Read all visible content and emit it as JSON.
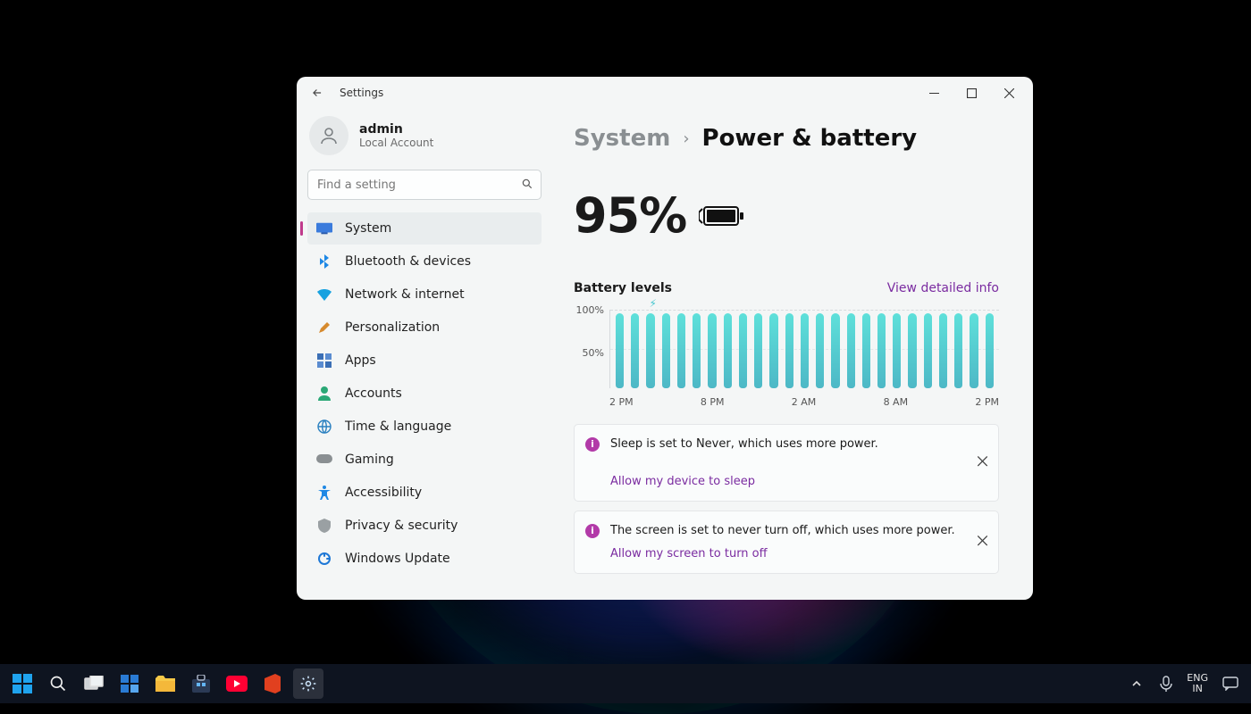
{
  "window": {
    "title": "Settings",
    "user": {
      "name": "admin",
      "type": "Local Account"
    },
    "search": {
      "placeholder": "Find a setting"
    }
  },
  "sidebar": {
    "items": [
      {
        "label": "System",
        "selected": true
      },
      {
        "label": "Bluetooth & devices"
      },
      {
        "label": "Network & internet"
      },
      {
        "label": "Personalization"
      },
      {
        "label": "Apps"
      },
      {
        "label": "Accounts"
      },
      {
        "label": "Time & language"
      },
      {
        "label": "Gaming"
      },
      {
        "label": "Accessibility"
      },
      {
        "label": "Privacy & security"
      },
      {
        "label": "Windows Update"
      }
    ]
  },
  "breadcrumb": {
    "parent": "System",
    "current": "Power & battery"
  },
  "battery": {
    "percent_text": "95%",
    "charging": true
  },
  "chart_link": "View detailed info",
  "chart_data": {
    "type": "bar",
    "title": "Battery levels",
    "xlabel": "",
    "ylabel": "",
    "ylim": [
      0,
      100
    ],
    "yticks": [
      "100%",
      "50%"
    ],
    "categories": [
      "2 PM",
      "3 PM",
      "4 PM",
      "5 PM",
      "6 PM",
      "7 PM",
      "8 PM",
      "9 PM",
      "10 PM",
      "11 PM",
      "12 AM",
      "1 AM",
      "2 AM",
      "3 AM",
      "4 AM",
      "5 AM",
      "6 AM",
      "7 AM",
      "8 AM",
      "9 AM",
      "10 AM",
      "11 AM",
      "12 PM",
      "1 PM",
      "2 PM"
    ],
    "xticks_shown": [
      "2 PM",
      "8 PM",
      "2 AM",
      "8 AM",
      "2 PM"
    ],
    "values": [
      95,
      95,
      95,
      95,
      95,
      95,
      95,
      95,
      95,
      95,
      95,
      95,
      95,
      95,
      95,
      95,
      95,
      95,
      95,
      95,
      95,
      95,
      95,
      95,
      95
    ],
    "charging_marker_index": 2
  },
  "tips": [
    {
      "text": "Sleep is set to Never, which uses more power.",
      "link": "Allow my device to sleep"
    },
    {
      "text": "The screen is set to never turn off, which uses more power.",
      "link": "Allow my screen to turn off"
    }
  ],
  "systray": {
    "lang_top": "ENG",
    "lang_bot": "IN"
  }
}
